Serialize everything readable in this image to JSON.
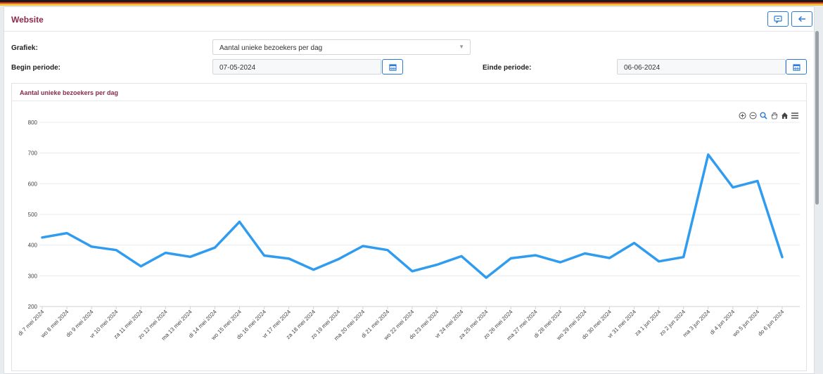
{
  "header": {
    "title": "Website"
  },
  "form": {
    "grafiek_label": "Grafiek:",
    "grafiek_value": "Aantal unieke bezoekers per dag",
    "begin_label": "Begin periode:",
    "begin_value": "07-05-2024",
    "einde_label": "Einde periode:",
    "einde_value": "06-06-2024"
  },
  "icons": {
    "comment": "comment-icon",
    "back": "arrow-left-icon",
    "calendar": "calendar-icon",
    "zoom_in": "zoom-in-icon",
    "zoom_out": "zoom-out-icon",
    "selection_zoom": "magnifier-icon",
    "pan": "hand-icon",
    "reset": "home-icon",
    "menu": "menu-icon"
  },
  "colors": {
    "accent": "#2b7bd6",
    "title": "#8a2a4a",
    "series": "#2f9cf0"
  },
  "chart_data": {
    "type": "line",
    "title": "Aantal unieke bezoekers per dag",
    "ylim": [
      200,
      800
    ],
    "yticks": [
      200,
      300,
      400,
      500,
      600,
      700,
      800
    ],
    "grid": true,
    "categories": [
      "di 7 mei 2024",
      "wo 8 mei 2024",
      "do 9 mei 2024",
      "vr 10 mei 2024",
      "za 11 mei 2024",
      "zo 12 mei 2024",
      "ma 13 mei 2024",
      "di 14 mei 2024",
      "wo 15 mei 2024",
      "do 16 mei 2024",
      "vr 17 mei 2024",
      "za 18 mei 2024",
      "zo 19 mei 2024",
      "ma 20 mei 2024",
      "di 21 mei 2024",
      "wo 22 mei 2024",
      "do 23 mei 2024",
      "vr 24 mei 2024",
      "za 25 mei 2024",
      "zo 26 mei 2024",
      "ma 27 mei 2024",
      "di 28 mei 2024",
      "wo 29 mei 2024",
      "do 30 mei 2024",
      "vr 31 mei 2024",
      "za 1 jun 2024",
      "zo 2 jun 2024",
      "ma 3 jun 2024",
      "di 4 jun 2024",
      "wo 5 jun 2024",
      "do 6 jun 2024"
    ],
    "values": [
      425,
      439,
      395,
      384,
      331,
      375,
      362,
      392,
      476,
      366,
      356,
      320,
      354,
      397,
      384,
      315,
      336,
      364,
      294,
      357,
      367,
      344,
      373,
      358,
      407,
      347,
      361,
      695,
      588,
      609,
      361
    ]
  }
}
